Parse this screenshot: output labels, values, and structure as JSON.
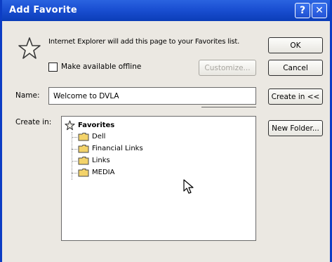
{
  "window": {
    "title": "Add Favorite",
    "help_icon": "question-mark-icon",
    "close_icon": "close-x-icon"
  },
  "intro_text": "Internet Explorer will add this page to your Favorites list.",
  "offline": {
    "label": "Make available offline",
    "checked": false,
    "customize_label": "Customize..."
  },
  "buttons": {
    "ok": "OK",
    "cancel": "Cancel",
    "create_in": "Create in <<",
    "new_folder": "New Folder..."
  },
  "name_field": {
    "label": "Name:",
    "value": "Welcome to DVLA"
  },
  "create_in": {
    "label": "Create in:",
    "root": "Favorites",
    "folders": [
      "Dell",
      "Financial Links",
      "Links",
      "MEDIA"
    ]
  },
  "colors": {
    "titlebar": "#1a4fd2",
    "dialog_bg": "#ebe8e2",
    "star_outline": "#4a4a4a",
    "folder": "#f3d36a"
  }
}
